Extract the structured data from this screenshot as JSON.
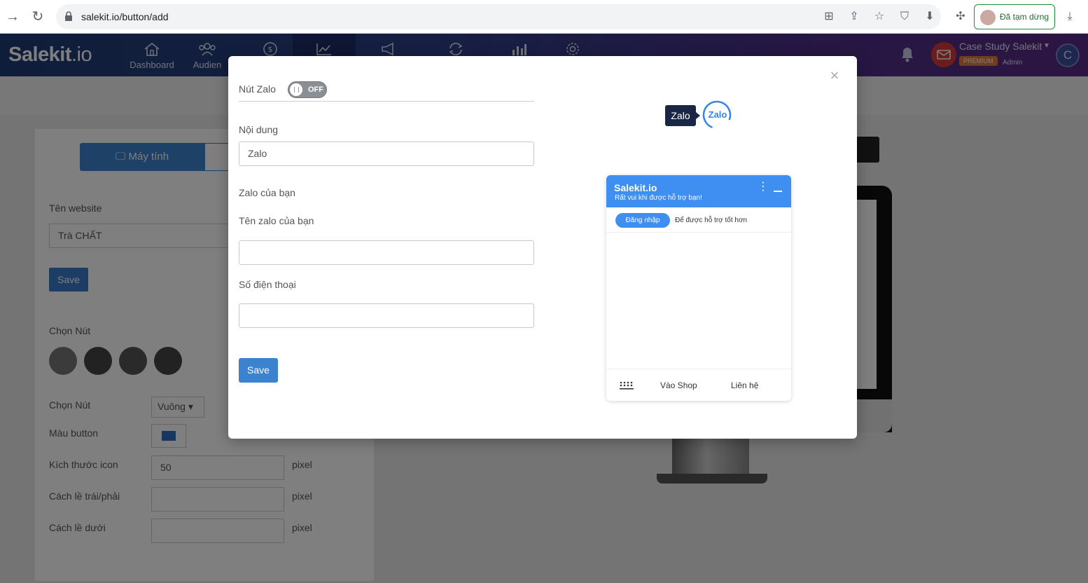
{
  "browser": {
    "url": "salekit.io/button/add",
    "profile_label": "Đã tạm dừng"
  },
  "app": {
    "logo_main": "Salekit",
    "logo_suffix": ".io",
    "nav": [
      {
        "label": "Dashboard",
        "icon": "home-icon"
      },
      {
        "label": "Audien",
        "icon": "users-icon"
      },
      {
        "label": "",
        "icon": "dollar-icon"
      },
      {
        "label": "",
        "icon": "chart-icon"
      },
      {
        "label": "",
        "icon": "megaphone-icon"
      },
      {
        "label": "",
        "icon": "refresh-icon"
      },
      {
        "label": "",
        "icon": "bar-chart-icon"
      },
      {
        "label": "",
        "icon": "gear-icon"
      }
    ],
    "user_name": "Case Study Salekit",
    "badge": "PREMIUM",
    "role": "Admin",
    "avatar_letter": "C"
  },
  "background_form": {
    "tab_desktop": "Máy tính",
    "website_label": "Tên website",
    "website_value": "Trà CHẤT",
    "save_label": "Save",
    "choose_button_label": "Chọn Nút",
    "choose_shape_label": "Chọn Nút",
    "shape_value": "Vuông",
    "color_label": "Màu button",
    "icon_size_label": "Kích thước icon",
    "icon_size_value": "50",
    "margin_lr_label": "Cách lề trái/phải",
    "margin_bottom_label": "Cách lề dưới",
    "unit": "pixel",
    "color_value": "#2f6fc4"
  },
  "modal": {
    "toggle_label": "Nút Zalo",
    "toggle_state": "OFF",
    "content_label": "Nội dung",
    "content_value": "Zalo",
    "section_label": "Zalo của bạn",
    "zalo_name_label": "Tên zalo của bạn",
    "zalo_name_value": "",
    "phone_label": "Số điện thoại",
    "phone_value": "",
    "save_label": "Save"
  },
  "preview": {
    "pill_text": "Zalo",
    "logo_text": "Zalo",
    "chat_title": "Salekit.io",
    "chat_subtitle": "Rất vui khi được hỗ trợ bạn!",
    "login_button": "Đăng nhập",
    "login_note": "Để được hỗ trợ tốt hơn",
    "footer_shop": "Vào Shop",
    "footer_contact": "Liên hệ"
  },
  "colors": {
    "accent": "#3b82cf",
    "chat_header": "#3f8ef2",
    "header_start": "#1d3b73",
    "header_end": "#5a2a86"
  }
}
